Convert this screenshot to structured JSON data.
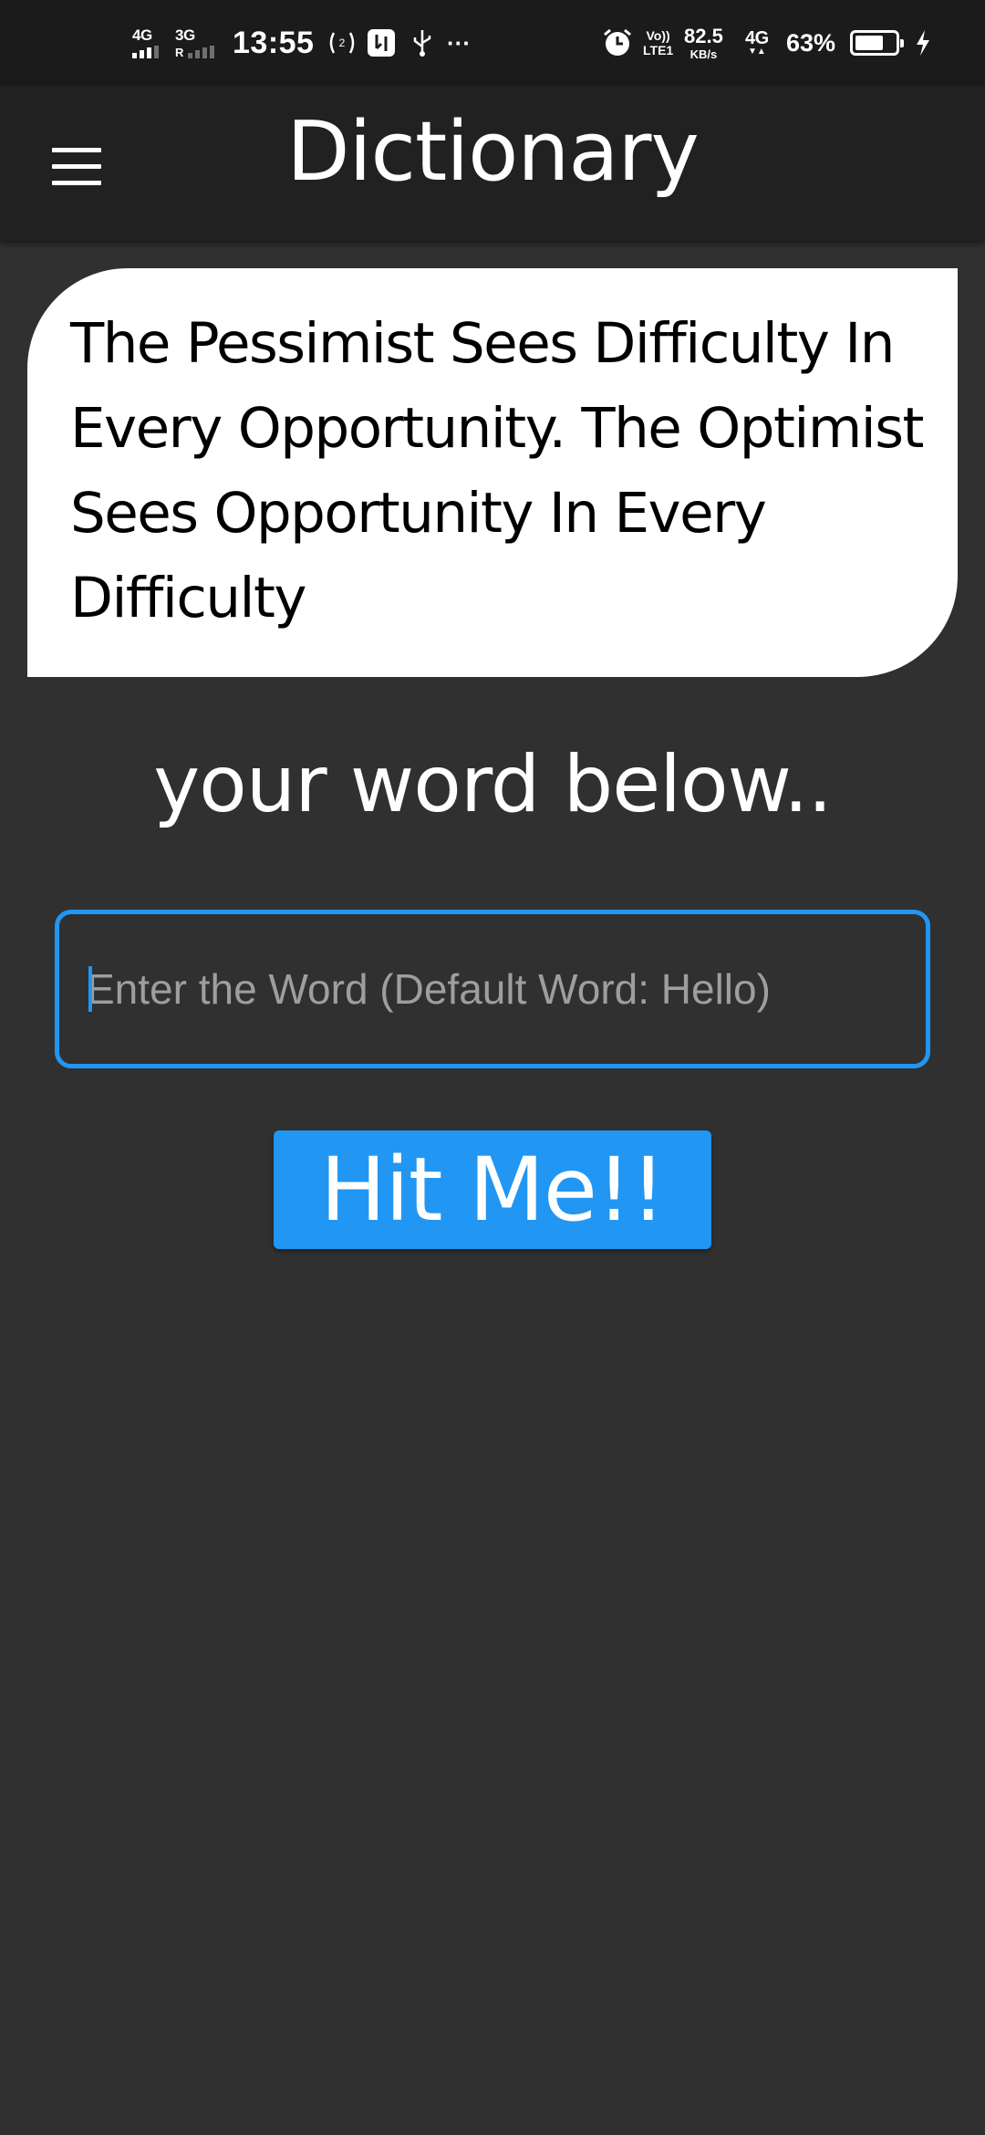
{
  "status_bar": {
    "signal1_label": "4G",
    "signal2_label": "3G",
    "signal2_sub": "R",
    "time": "13:55",
    "hotspot_icon": "hotspot-icon",
    "usb_debug_icon": "usb-debug-icon",
    "usb_icon": "usb-icon",
    "more_notifications": "···",
    "alarm_icon": "alarm-icon",
    "volte_top": "Vo))",
    "volte_bottom": "LTE1",
    "net_speed_value": "82.5",
    "net_speed_unit": "KB/s",
    "data_label": "4G",
    "battery_percent": "63%",
    "charging_icon": "charging-icon"
  },
  "app_bar": {
    "menu_icon": "hamburger-menu-icon",
    "title": "Dictionary"
  },
  "quote": {
    "text": "The Pessimist Sees Difficulty In Every Opportunity. The Optimist Sees Opportunity In Every Difficulty"
  },
  "prompt": {
    "text": "your word below.."
  },
  "search": {
    "value": "",
    "placeholder": "Enter the Word (Default Word: Hello)"
  },
  "action": {
    "label": "Hit Me!!"
  },
  "colors": {
    "background": "#303030",
    "app_bar": "#212121",
    "status_bar": "#1b1b1b",
    "accent": "#2196f3",
    "card": "#ffffff"
  }
}
